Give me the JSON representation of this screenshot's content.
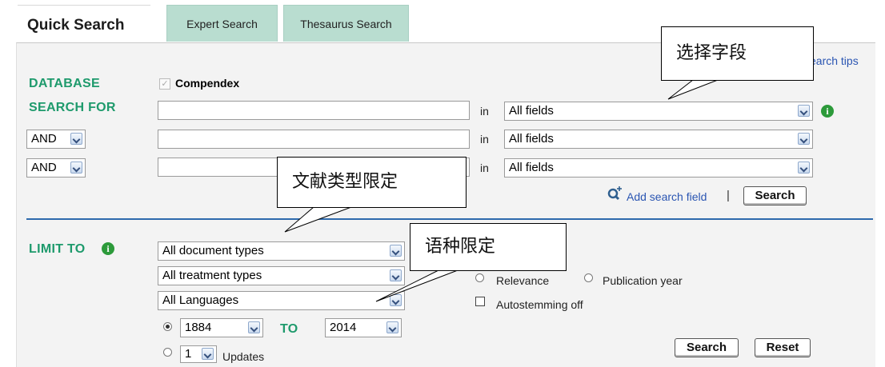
{
  "tabs": [
    {
      "label": "Quick Search",
      "active": true
    },
    {
      "label": "Expert Search",
      "active": false
    },
    {
      "label": "Thesaurus Search",
      "active": false
    }
  ],
  "search_tips": "earch tips",
  "database": {
    "label": "DATABASE",
    "name": "Compendex",
    "checked": true
  },
  "search_for": {
    "label": "SEARCH FOR"
  },
  "rows": [
    {
      "operator": null,
      "value": "",
      "in_label": "in",
      "field": "All fields"
    },
    {
      "operator": "AND",
      "value": "",
      "in_label": "in",
      "field": "All fields"
    },
    {
      "operator": "AND",
      "value": "",
      "in_label": "in",
      "field": "All fields"
    }
  ],
  "add_field": {
    "label": "Add search field",
    "separator": "|",
    "icon": "magnifier-plus-icon"
  },
  "search_button": "Search",
  "limit": {
    "label": "LIMIT TO",
    "document_types": "All document types",
    "treatment_types": "All treatment types",
    "languages": "All Languages",
    "year_from": "1884",
    "to_label": "TO",
    "year_to": "2014",
    "updates_count": "1",
    "updates_label": "Updates"
  },
  "sort": {
    "relevance": "Relevance",
    "publication_year": "Publication year"
  },
  "autostemming": "Autostemming off",
  "bottom_buttons": {
    "search": "Search",
    "reset": "Reset"
  },
  "callouts": {
    "fields": "选择字段",
    "doctype": "文献类型限定",
    "language": "语种限定"
  },
  "colors": {
    "label_green": "#1e9a6c",
    "tab_bg": "#b9ddd0",
    "divider": "#2e6aad",
    "info_icon": "#2c9a3a",
    "link": "#2a55b2"
  }
}
